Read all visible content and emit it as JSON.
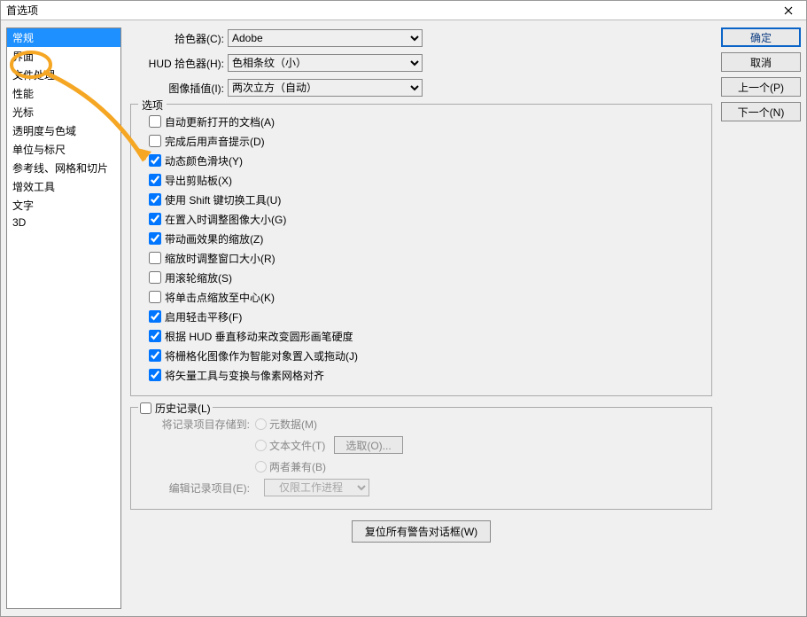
{
  "title": "首选项",
  "sidebar": {
    "items": [
      {
        "label": "常规",
        "selected": true
      },
      {
        "label": "界面"
      },
      {
        "label": "文件处理"
      },
      {
        "label": "性能"
      },
      {
        "label": "光标"
      },
      {
        "label": "透明度与色域"
      },
      {
        "label": "单位与标尺"
      },
      {
        "label": "参考线、网格和切片"
      },
      {
        "label": "增效工具"
      },
      {
        "label": "文字"
      },
      {
        "label": "3D"
      }
    ]
  },
  "pickers": {
    "picker_label": "拾色器(C):",
    "picker_value": "Adobe",
    "hud_label": "HUD 拾色器(H):",
    "hud_value": "色相条纹（小）",
    "interp_label": "图像插值(I):",
    "interp_value": "两次立方（自动）"
  },
  "buttons": {
    "ok": "确定",
    "cancel": "取消",
    "prev": "上一个(P)",
    "next": "下一个(N)"
  },
  "options": {
    "legend": "选项",
    "items": [
      {
        "label": "自动更新打开的文档(A)",
        "checked": false
      },
      {
        "label": "完成后用声音提示(D)",
        "checked": false
      },
      {
        "label": "动态颜色滑块(Y)",
        "checked": true
      },
      {
        "label": "导出剪贴板(X)",
        "checked": true
      },
      {
        "label": "使用 Shift 键切换工具(U)",
        "checked": true
      },
      {
        "label": "在置入时调整图像大小(G)",
        "checked": true
      },
      {
        "label": "带动画效果的缩放(Z)",
        "checked": true
      },
      {
        "label": "缩放时调整窗口大小(R)",
        "checked": false
      },
      {
        "label": "用滚轮缩放(S)",
        "checked": false
      },
      {
        "label": "将单击点缩放至中心(K)",
        "checked": false
      },
      {
        "label": "启用轻击平移(F)",
        "checked": true
      },
      {
        "label": "根据 HUD 垂直移动来改变圆形画笔硬度",
        "checked": true
      },
      {
        "label": "将栅格化图像作为智能对象置入或拖动(J)",
        "checked": true
      },
      {
        "label": "将矢量工具与变换与像素网格对齐",
        "checked": true
      }
    ]
  },
  "history": {
    "legend": "历史记录(L)",
    "save_label": "将记录项目存储到:",
    "meta": "元数据(M)",
    "text": "文本文件(T)",
    "both": "两者兼有(B)",
    "choose": "选取(O)...",
    "edit_label": "编辑记录项目(E):",
    "edit_value": "仅限工作进程"
  },
  "reset": "复位所有警告对话框(W)"
}
